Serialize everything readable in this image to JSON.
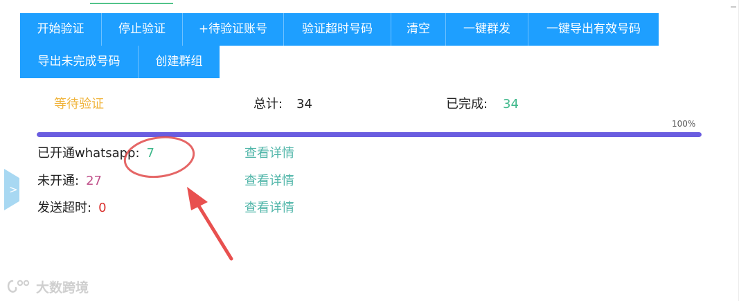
{
  "toolbar": {
    "buttons": [
      "开始验证",
      "停止验证",
      "+待验证账号",
      "验证超时号码",
      "清空",
      "一键群发",
      "一键导出有效号码",
      "导出未完成号码",
      "创建群组"
    ],
    "button_color": "#1e9fff"
  },
  "side_handle": {
    "label": ">"
  },
  "status": {
    "state": "等待验证",
    "total_label": "总计:",
    "total_value": "34",
    "done_label": "已完成:",
    "done_value": "34"
  },
  "progress": {
    "percent_text": "100%",
    "value": 1.0,
    "color": "#6a5de0"
  },
  "results": [
    {
      "label": "已开通whatsapp:",
      "value": "7",
      "link": "查看详情"
    },
    {
      "label": "未开通:",
      "value": "27",
      "link": "查看详情"
    },
    {
      "label": "发送超时:",
      "value": "0",
      "link": "查看详情"
    }
  ],
  "watermark": {
    "text": "大数跨境"
  }
}
